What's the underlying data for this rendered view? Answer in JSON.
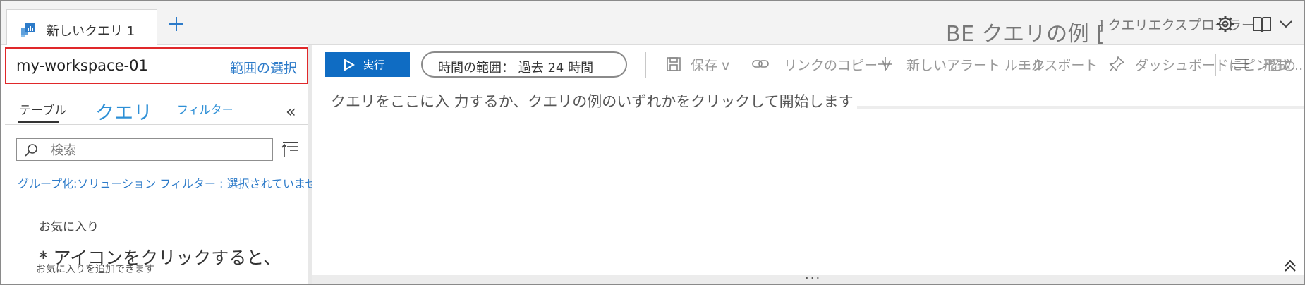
{
  "tab": {
    "title": "新しいクエリ 1",
    "add_label": "+"
  },
  "header": {
    "title": "BE クエリの例 [",
    "explorer": "] クエリエクスプローラー"
  },
  "workspace": {
    "name": "my-workspace-01",
    "select_label": "範囲の選択"
  },
  "left_tabs": {
    "table": "テーブル",
    "query": "クエリ",
    "filter": "フィルター",
    "collapse": "«"
  },
  "search": {
    "placeholder": "検索"
  },
  "grouping": "グループ化:ソリューション フィルター : 選択されていません",
  "favorites": {
    "title": "お気に入り",
    "message": "* アイコンをクリックすると、",
    "sub": "お気に入りを追加できます"
  },
  "toolbar": {
    "run": "実行",
    "time_range": "時間の範囲： 過去 24 時間",
    "save": "保存 v",
    "copy_link": "リンクのコピー V",
    "new_alert": "新しいアラート ルール",
    "export": "エクスポート",
    "pin": "ダッシュボードにピン留め",
    "format": "形式..."
  },
  "editor": {
    "hint": "クエリをここに入 力するか、クエリの例のいずれかをクリックして開始します",
    "dots": "..."
  },
  "colors": {
    "accent": "#0f6cc3",
    "link": "#2d7bc9",
    "highlight": "#e0282a"
  }
}
